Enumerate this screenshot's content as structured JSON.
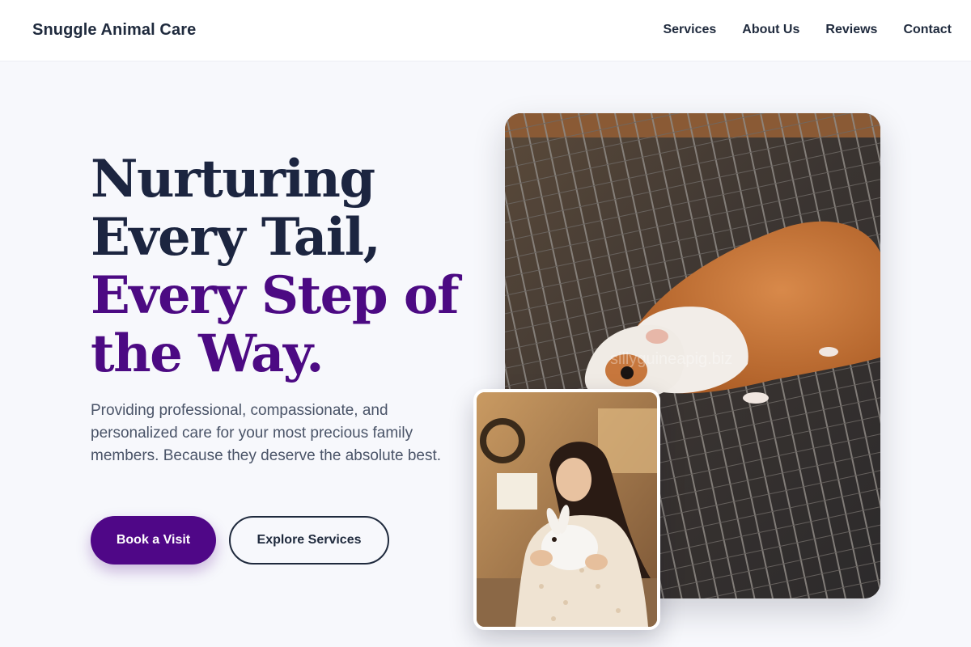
{
  "header": {
    "brand": "Snuggle Animal Care",
    "nav": [
      "Services",
      "About Us",
      "Reviews",
      "Contact"
    ]
  },
  "hero": {
    "headline_dark": "Nurturing Every Tail,",
    "headline_accent": "Every Step of the Way.",
    "subtext": "Providing professional, compassionate, and personalized care for your most precious family members. Because they deserve the absolute best.",
    "primary_button": "Book a Visit",
    "secondary_button": "Explore Services"
  },
  "images": {
    "main_watermark": "sillyguineapig.biz"
  },
  "colors": {
    "accent": "#4f0787",
    "text_dark": "#1c2540",
    "background": "#f7f8fc"
  }
}
